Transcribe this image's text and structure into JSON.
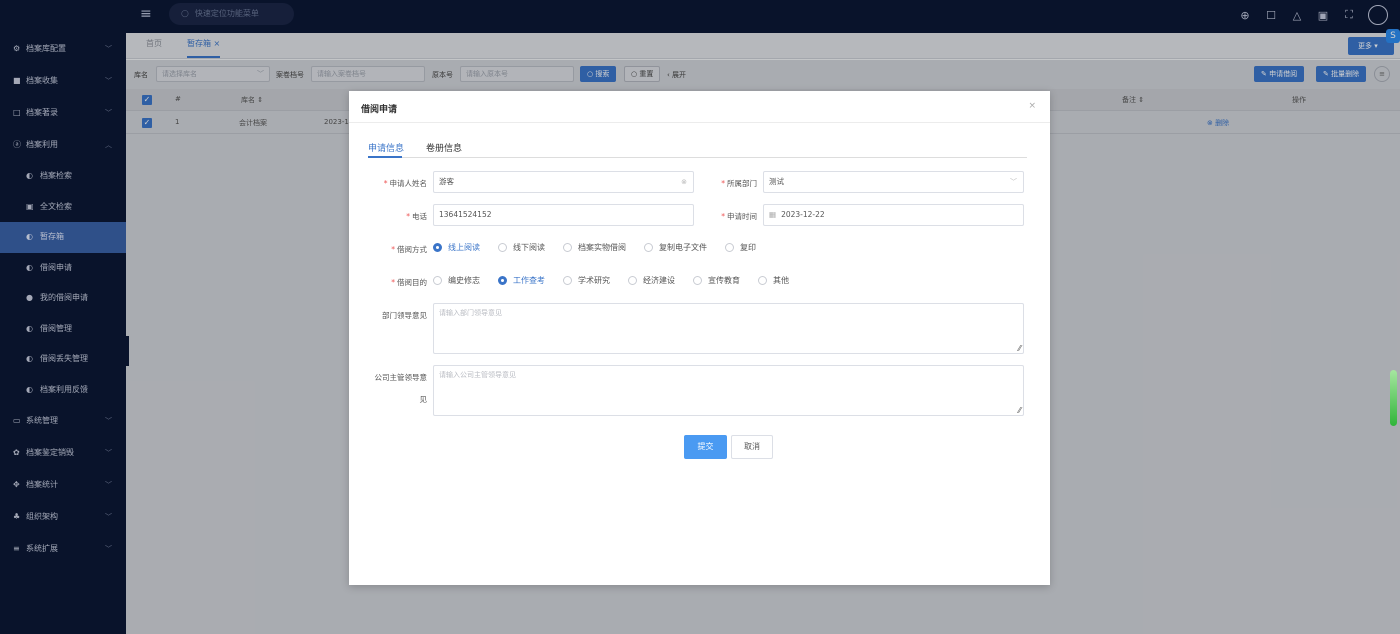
{
  "topbar": {
    "search_placeholder": "快速定位功能菜单",
    "icons": [
      "lock-icon",
      "shirt-icon",
      "bell-icon",
      "translate-icon",
      "fullscreen-icon",
      "avatar-icon"
    ]
  },
  "sidebar": {
    "items": [
      {
        "label": "档案库配置",
        "icon": "gears-icon"
      },
      {
        "label": "档案收集",
        "icon": "box-icon"
      },
      {
        "label": "档案著录",
        "icon": "calendar-icon"
      },
      {
        "label": "档案利用",
        "icon": "person-icon"
      },
      {
        "label": "系统管理",
        "icon": "monitor-icon"
      },
      {
        "label": "档案鉴定销毁",
        "icon": "recycle-icon"
      },
      {
        "label": "档案统计",
        "icon": "arrows-icon"
      },
      {
        "label": "组织架构",
        "icon": "sitemap-icon"
      },
      {
        "label": "系统扩展",
        "icon": "list-icon"
      }
    ],
    "sub_items": [
      {
        "label": "档案检索"
      },
      {
        "label": "全文检索"
      },
      {
        "label": "暂存箱"
      },
      {
        "label": "借阅申请"
      },
      {
        "label": "我的借阅申请"
      },
      {
        "label": "借阅管理"
      },
      {
        "label": "借阅丢失管理"
      },
      {
        "label": "档案利用反馈"
      }
    ],
    "active_sub": "暂存箱"
  },
  "tabs": {
    "home": "首页",
    "active": "暂存箱",
    "more": "更多"
  },
  "filters": {
    "lib_label": "库名",
    "lib_placeholder": "请选择库名",
    "dossier_label": "案卷档号",
    "dossier_placeholder": "请输入案卷档号",
    "doc_label": "原本号",
    "doc_placeholder": "请输入原本号",
    "search_btn": "搜索",
    "reset_btn": "重置",
    "expand": "展开",
    "apply_btn": "申请借阅",
    "batch_delete_btn": "批量删除"
  },
  "table": {
    "headers": {
      "index": "#",
      "lib": "库名",
      "note": "备注",
      "ops": "操作"
    },
    "rows": [
      {
        "index": "1",
        "lib": "会计档案",
        "date": "2023-1",
        "op": "删除"
      }
    ]
  },
  "modal": {
    "title": "借阅申请",
    "tabs": [
      "申请信息",
      "卷册信息"
    ],
    "fields": {
      "name_label": "申请人姓名",
      "name_value": "游客",
      "dept_label": "所属部门",
      "dept_value": "测试",
      "phone_label": "电话",
      "phone_value": "13641524152",
      "date_label": "申请时间",
      "date_value": "2023-12-22",
      "method_label": "借阅方式",
      "purpose_label": "借阅目的",
      "dept_opinion_label": "部门领导意见",
      "dept_opinion_placeholder": "请输入部门领导意见",
      "company_opinion_label_1": "公司主管领导意",
      "company_opinion_label_2": "见",
      "company_opinion_placeholder": "请输入公司主管领导意见"
    },
    "methods": [
      {
        "label": "线上阅读",
        "selected": true
      },
      {
        "label": "线下阅读",
        "selected": false
      },
      {
        "label": "档案实物借阅",
        "selected": false
      },
      {
        "label": "复制电子文件",
        "selected": false
      },
      {
        "label": "复印",
        "selected": false
      }
    ],
    "purposes": [
      {
        "label": "编史修志",
        "selected": false
      },
      {
        "label": "工作查考",
        "selected": true
      },
      {
        "label": "学术研究",
        "selected": false
      },
      {
        "label": "经济建设",
        "selected": false
      },
      {
        "label": "宣传教育",
        "selected": false
      },
      {
        "label": "其他",
        "selected": false
      }
    ],
    "submit": "提交",
    "cancel": "取消"
  },
  "colors": {
    "sidebar_bg": "#0b1835",
    "accent": "#3a74c8",
    "submit": "#4a9af2",
    "required": "#e55555"
  }
}
